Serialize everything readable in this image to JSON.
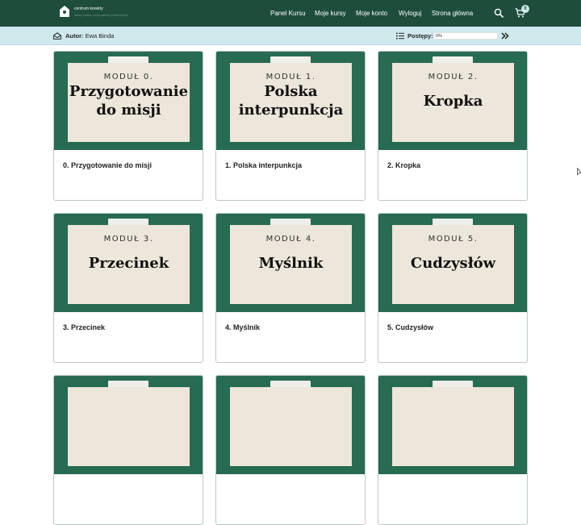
{
  "brand": {
    "name": "centrum korekty",
    "tagline": "kursy online z poprawnej polszczyzny",
    "color": "#1e4d3c"
  },
  "nav": {
    "items": [
      "Panel Kursu",
      "Moje kursy",
      "Moje konto",
      "Wyloguj",
      "Strona główna"
    ]
  },
  "cart": {
    "count": "0"
  },
  "subbar": {
    "author_label": "Autor:",
    "author_name": "Ewa Binda",
    "progress_label": "Postępy:",
    "progress_value": "0%",
    "progress_fraction": 0,
    "background": "#cfe9ec"
  },
  "modules": [
    {
      "number": "MODUŁ 0.",
      "title_lines": [
        "Przygotowanie",
        "do misji"
      ],
      "caption": "0. Przygotowanie do misji"
    },
    {
      "number": "MODUŁ 1.",
      "title_lines": [
        "Polska",
        "interpunkcja"
      ],
      "caption": "1. Polska interpunkcja"
    },
    {
      "number": "MODUŁ 2.",
      "title_lines": [
        "Kropka"
      ],
      "caption": "2. Kropka"
    },
    {
      "number": "MODUŁ 3.",
      "title_lines": [
        "Przecinek"
      ],
      "caption": "3. Przecinek"
    },
    {
      "number": "MODUŁ 4.",
      "title_lines": [
        "Myślnik"
      ],
      "caption": "4. Myślnik"
    },
    {
      "number": "MODUŁ 5.",
      "title_lines": [
        "Cudzysłów"
      ],
      "caption": "5. Cudzysłów"
    }
  ],
  "icons": {
    "logo": "house-logo-icon",
    "search": "search-icon",
    "cart": "cart-icon",
    "author": "envelope-open-icon",
    "progress": "list-icon",
    "expand": "double-chevron-right-icon"
  }
}
